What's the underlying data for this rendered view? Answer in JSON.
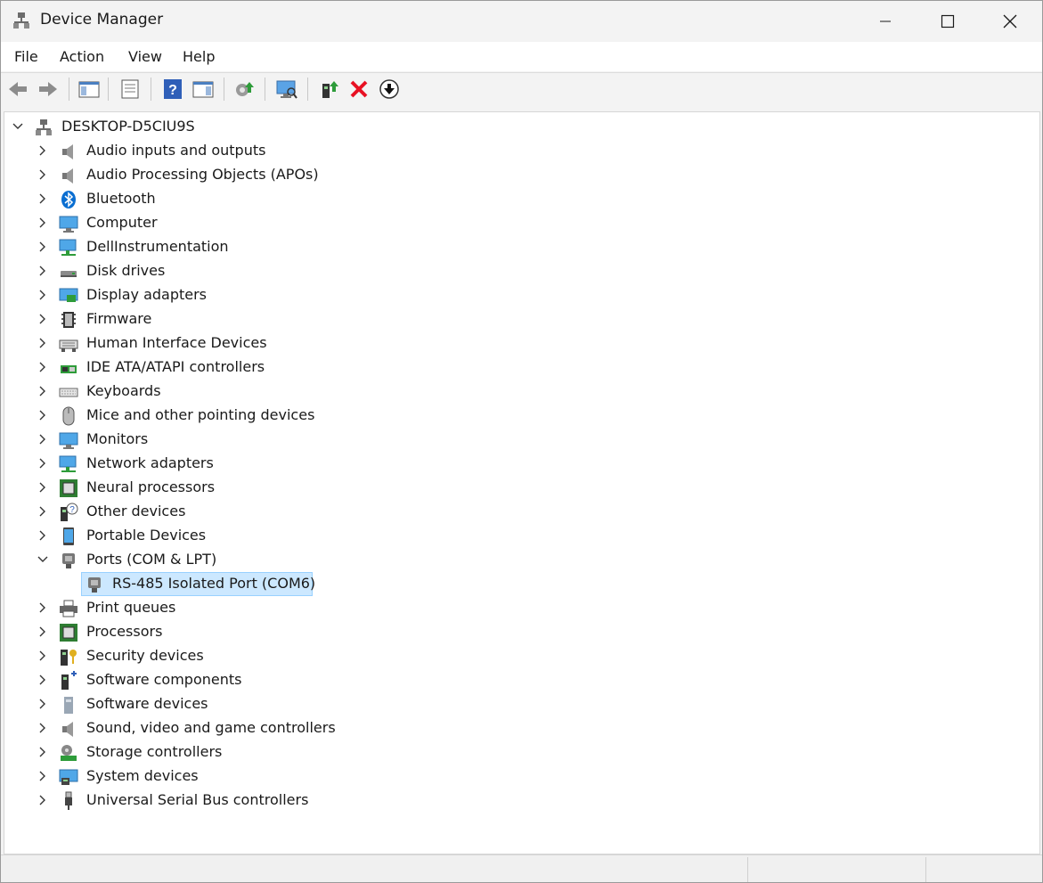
{
  "window": {
    "title": "Device Manager"
  },
  "menu": [
    "File",
    "Action",
    "View",
    "Help"
  ],
  "toolbar": {
    "buttons": [
      "back-icon",
      "forward-icon",
      "show-hide-console-tree-icon",
      "properties-icon",
      "help-icon",
      "action-pane-icon",
      "update-driver-icon",
      "scan-hardware-icon",
      "enable-device-icon",
      "uninstall-device-icon",
      "disable-device-icon"
    ]
  },
  "tree": {
    "root": "DESKTOP-D5CIU9S",
    "categories": [
      "Audio inputs and outputs",
      "Audio Processing Objects (APOs)",
      "Bluetooth",
      "Computer",
      "DellInstrumentation",
      "Disk drives",
      "Display adapters",
      "Firmware",
      "Human Interface Devices",
      "IDE ATA/ATAPI controllers",
      "Keyboards",
      "Mice and other pointing devices",
      "Monitors",
      "Network adapters",
      "Neural processors",
      "Other devices",
      "Portable Devices",
      "Ports (COM & LPT)",
      "Print queues",
      "Processors",
      "Security devices",
      "Software components",
      "Software devices",
      "Sound, video and game controllers",
      "Storage controllers",
      "System devices",
      "Universal Serial Bus controllers"
    ],
    "expanded_category": "Ports (COM & LPT)",
    "expanded_child": "RS-485 Isolated Port (COM6)",
    "selected": "RS-485 Isolated Port (COM6)"
  },
  "colors": {
    "selection_bg": "#cce8ff",
    "selection_border": "#99d1ff",
    "uninstall_red": "#e81123",
    "bluetooth_blue": "#0a6ed1"
  }
}
